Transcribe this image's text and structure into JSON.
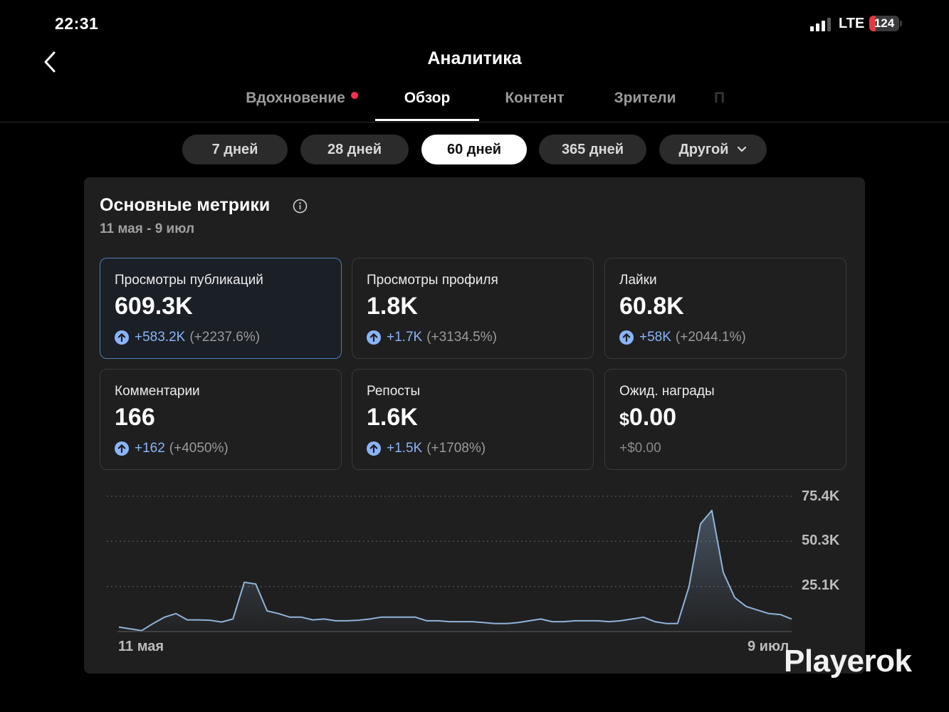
{
  "status_bar": {
    "time": "22:31",
    "network": "LTE",
    "battery": "124"
  },
  "header": {
    "title": "Аналитика"
  },
  "tabs": [
    {
      "label": "Вдохновение",
      "active": false,
      "badge": true
    },
    {
      "label": "Обзор",
      "active": true
    },
    {
      "label": "Контент",
      "active": false
    },
    {
      "label": "Зрители",
      "active": false
    },
    {
      "label": "П",
      "active": false
    }
  ],
  "periods": [
    {
      "label": "7 дней",
      "active": false
    },
    {
      "label": "28 дней",
      "active": false
    },
    {
      "label": "60 дней",
      "active": true
    },
    {
      "label": "365 дней",
      "active": false
    },
    {
      "label": "Другой",
      "active": false,
      "dropdown": true
    }
  ],
  "metrics_card": {
    "title": "Основные метрики",
    "date_range": "11 мая - 9 июл",
    "tiles": [
      {
        "label": "Просмотры публикаций",
        "value": "609.3K",
        "delta": "+583.2K",
        "pct": "(+2237.6%)",
        "selected": true
      },
      {
        "label": "Просмотры профиля",
        "value": "1.8K",
        "delta": "+1.7K",
        "pct": "(+3134.5%)"
      },
      {
        "label": "Лайки",
        "value": "60.8K",
        "delta": "+58K",
        "pct": "(+2044.1%)"
      },
      {
        "label": "Комментарии",
        "value": "166",
        "delta": "+162",
        "pct": "(+4050%)"
      },
      {
        "label": "Репосты",
        "value": "1.6K",
        "delta": "+1.5K",
        "pct": "(+1708%)"
      },
      {
        "label": "Ожид. награды",
        "currency": "$",
        "value": "0.00",
        "delta_plain": "+$0.00"
      }
    ]
  },
  "chart_data": {
    "type": "area",
    "y_ticks": [
      "75.4K",
      "50.3K",
      "25.1K"
    ],
    "y_tick_values": [
      75400,
      50300,
      25100
    ],
    "x_labels": [
      "11 мая",
      "9 июл"
    ],
    "ylim": [
      0,
      75400
    ],
    "grid": true,
    "line_color": "#8fb3d9",
    "values": [
      2500,
      1500,
      500,
      4500,
      8000,
      10000,
      6500,
      6500,
      6300,
      5300,
      7000,
      27500,
      26500,
      11500,
      10000,
      8000,
      8000,
      6500,
      7000,
      6000,
      6000,
      6300,
      7000,
      8000,
      8000,
      8000,
      8000,
      6000,
      6000,
      5500,
      5500,
      5500,
      5000,
      4500,
      4500,
      5000,
      6000,
      7000,
      5500,
      5500,
      6000,
      6000,
      6000,
      5500,
      6000,
      7000,
      8000,
      5500,
      4500,
      4500,
      25000,
      60000,
      67500,
      33000,
      19000,
      14000,
      12000,
      10000,
      9500,
      7000
    ]
  },
  "watermark": "Playerok"
}
